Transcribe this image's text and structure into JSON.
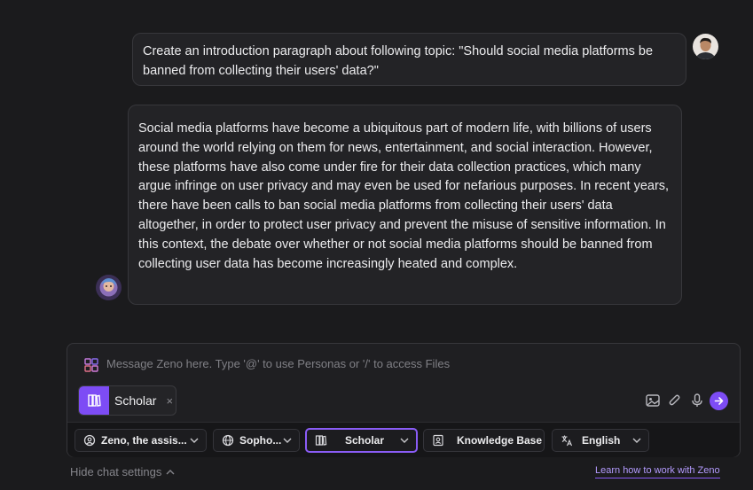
{
  "conversation": {
    "user_message": "Create an introduction paragraph about following topic: \"Should social media platforms be banned from collecting their users' data?\"",
    "assistant_message": "Social media platforms have become a ubiquitous part of modern life, with billions of users around the world relying on them for news, entertainment, and social interaction. However, these platforms have also come under fire for their data collection practices, which many argue infringe on user privacy and may even be used for nefarious purposes. In recent years, there have been calls to ban social media platforms from collecting their users' data altogether, in order to protect user privacy and prevent the misuse of sensitive information. In this context, the debate over whether or not social media platforms should be banned from collecting user data has become increasingly heated and complex."
  },
  "composer": {
    "placeholder": "Message Zeno here. Type '@' to use Personas or '/' to access Files",
    "active_chip": "Scholar",
    "chip_close": "×"
  },
  "settings": {
    "persona": "Zeno, the assis...",
    "model": "Sopho...",
    "mode": "Scholar",
    "knowledge": "Knowledge Base",
    "language": "English"
  },
  "footer": {
    "hide_label": "Hide chat settings",
    "learn_link": "Learn how to work with Zeno"
  },
  "colors": {
    "accent": "#7d4cf5",
    "background": "#1b1b1d",
    "bubble": "#232326"
  },
  "icons": [
    "grid-icon",
    "book-icon",
    "close-icon",
    "image-icon",
    "paperclip-icon",
    "microphone-icon",
    "send-icon",
    "persona-icon",
    "globe-icon",
    "knowledge-icon",
    "translate-icon",
    "chevron-down-icon",
    "chevron-up-icon"
  ]
}
